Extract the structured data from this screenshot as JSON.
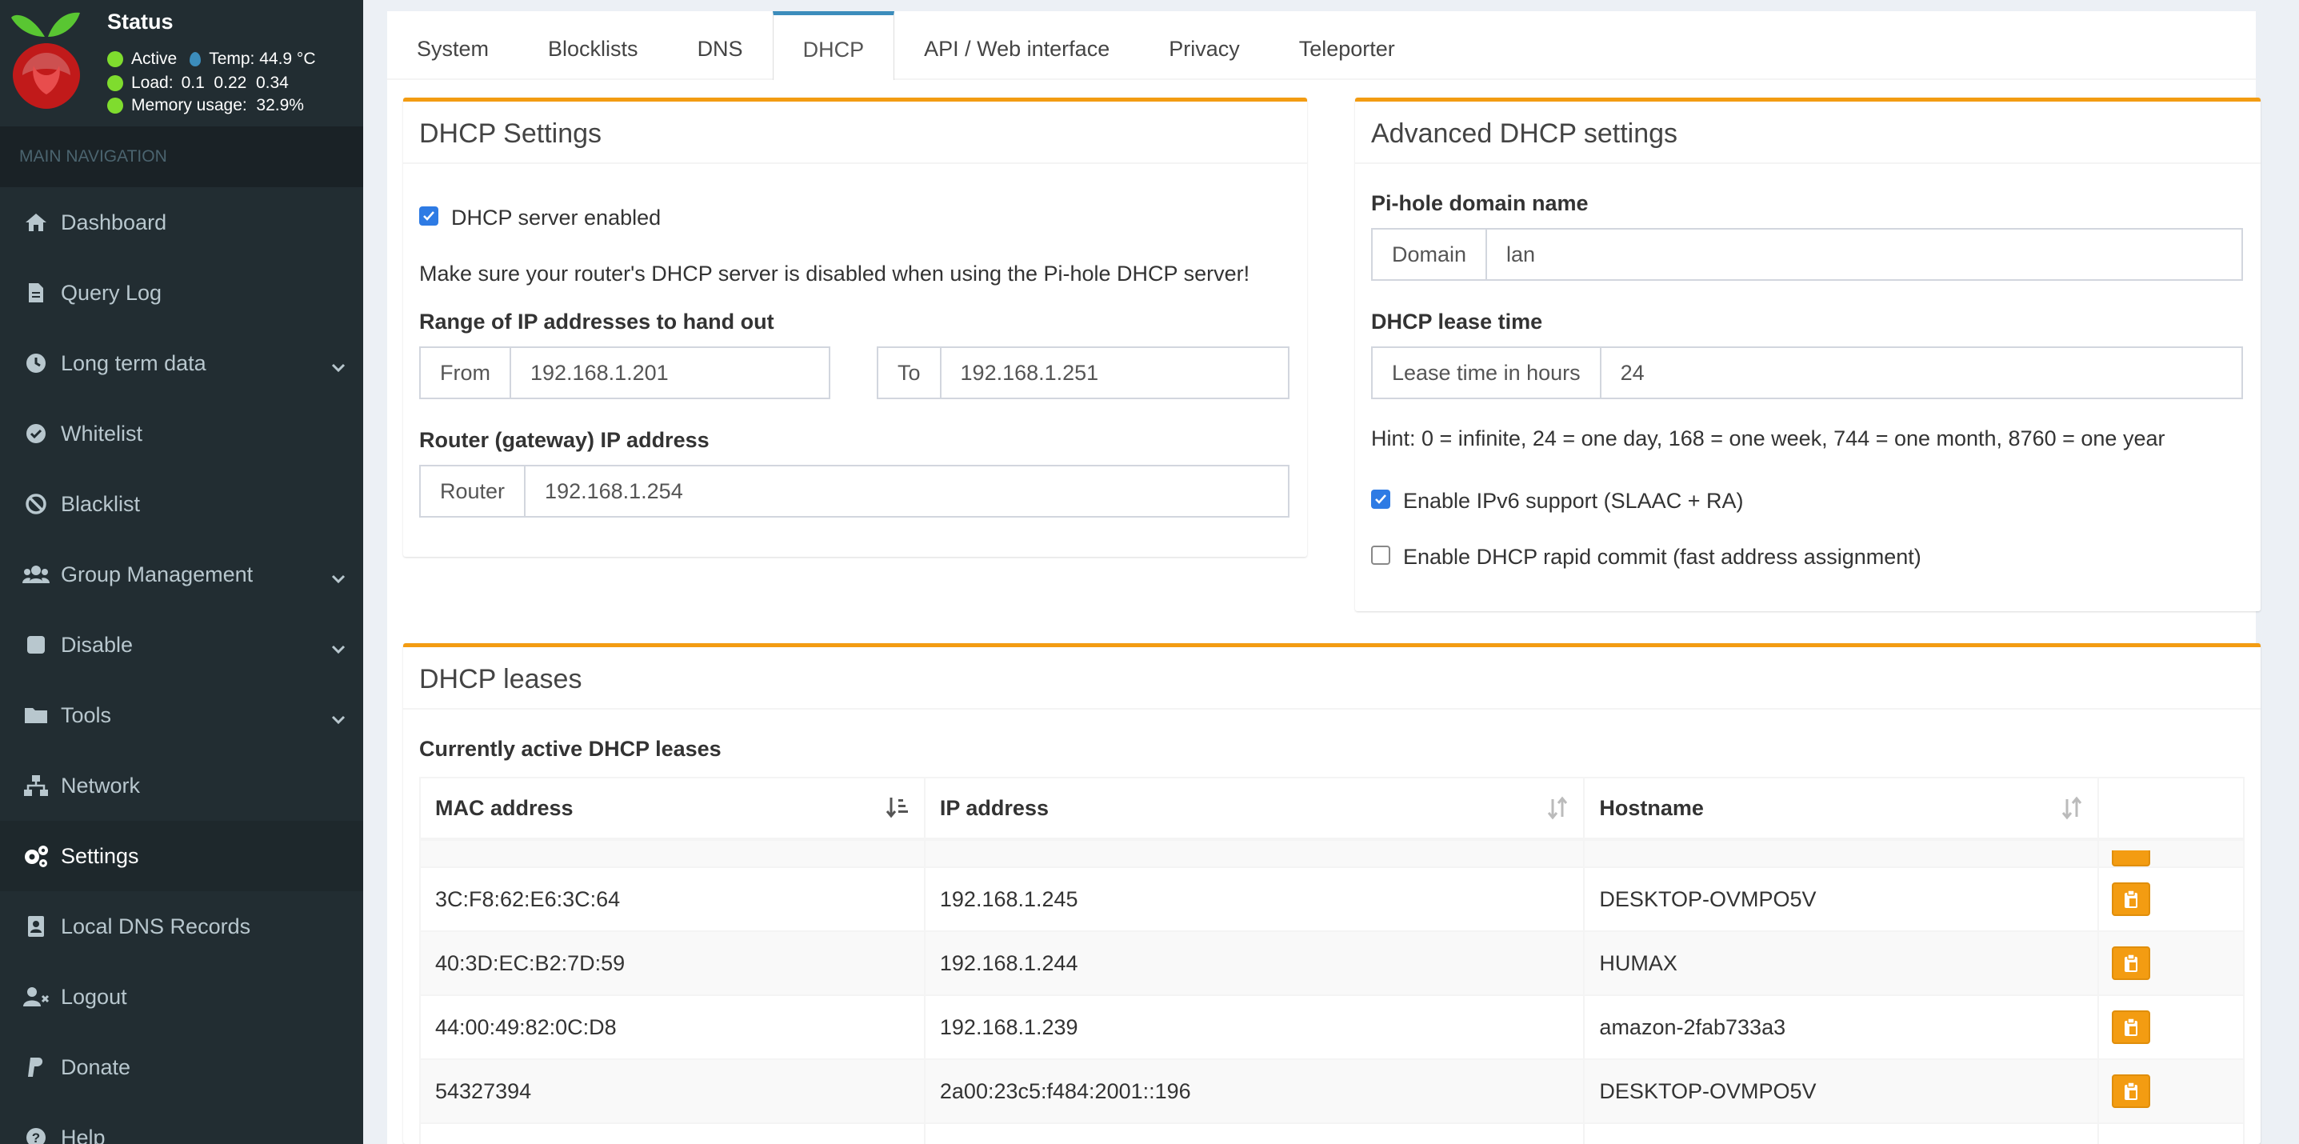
{
  "status": {
    "title": "Status",
    "active": "Active",
    "temp": "Temp: 44.9 °C",
    "load_label": "Load:",
    "load_values": "0.1  0.22  0.34",
    "memory": "Memory usage:  32.9%"
  },
  "nav": {
    "header": "MAIN NAVIGATION",
    "items": [
      {
        "label": "Dashboard",
        "icon": "home-icon"
      },
      {
        "label": "Query Log",
        "icon": "file-icon"
      },
      {
        "label": "Long term data",
        "icon": "clock-icon"
      },
      {
        "label": "Whitelist",
        "icon": "check-circle-icon"
      },
      {
        "label": "Blacklist",
        "icon": "ban-icon"
      },
      {
        "label": "Group Management",
        "icon": "users-icon"
      },
      {
        "label": "Disable",
        "icon": "stop-icon"
      },
      {
        "label": "Tools",
        "icon": "folder-icon"
      },
      {
        "label": "Network",
        "icon": "network-icon"
      },
      {
        "label": "Settings",
        "icon": "gears-icon"
      },
      {
        "label": "Local DNS Records",
        "icon": "address-book-icon"
      },
      {
        "label": "Logout",
        "icon": "user-times-icon"
      },
      {
        "label": "Donate",
        "icon": "paypal-icon"
      },
      {
        "label": "Help",
        "icon": "question-icon"
      }
    ]
  },
  "tabs": [
    "System",
    "Blocklists",
    "DNS",
    "DHCP",
    "API / Web interface",
    "Privacy",
    "Teleporter"
  ],
  "dhcp_settings": {
    "title": "DHCP Settings",
    "server_enabled": "DHCP server enabled",
    "warning": "Make sure your router's DHCP server is disabled when using the Pi-hole DHCP server!",
    "range_label": "Range of IP addresses to hand out",
    "from_label": "From",
    "from_value": "192.168.1.201",
    "to_label": "To",
    "to_value": "192.168.1.251",
    "router_label": "Router (gateway) IP address",
    "router_addon": "Router",
    "router_value": "192.168.1.254"
  },
  "advanced": {
    "title": "Advanced DHCP settings",
    "domain_label": "Pi-hole domain name",
    "domain_addon": "Domain",
    "domain_value": "lan",
    "lease_label": "DHCP lease time",
    "lease_addon": "Lease time in hours",
    "lease_value": "24",
    "hint": "Hint: 0 = infinite, 24 = one day, 168 = one week, 744 = one month, 8760 = one year",
    "ipv6": "Enable IPv6 support (SLAAC + RA)",
    "rapid": "Enable DHCP rapid commit (fast address assignment)"
  },
  "leases": {
    "title": "DHCP leases",
    "subtitle": "Currently active DHCP leases",
    "columns": [
      "MAC address",
      "IP address",
      "Hostname"
    ],
    "rows": [
      {
        "mac": "3C:F8:62:E6:3C:64",
        "ip": "192.168.1.245",
        "host": "DESKTOP-OVMPO5V"
      },
      {
        "mac": "40:3D:EC:B2:7D:59",
        "ip": "192.168.1.244",
        "host": "HUMAX"
      },
      {
        "mac": "44:00:49:82:0C:D8",
        "ip": "192.168.1.239",
        "host": "amazon-2fab733a3"
      },
      {
        "mac": "54327394",
        "ip": "2a00:23c5:f484:2001::196",
        "host": "DESKTOP-OVMPO5V"
      }
    ]
  }
}
